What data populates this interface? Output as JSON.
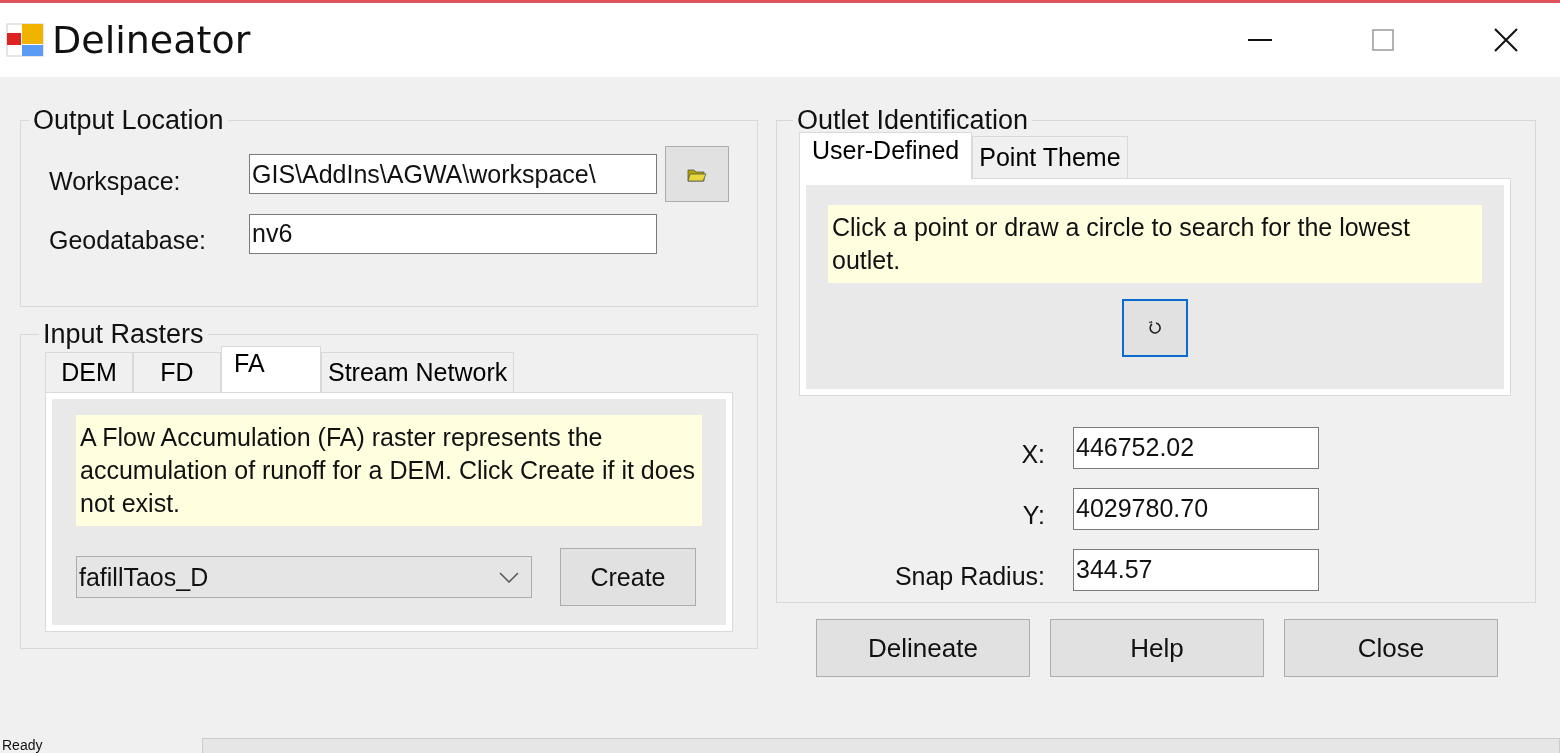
{
  "window": {
    "title": "Delineator"
  },
  "output_location": {
    "title": "Output Location",
    "workspace": {
      "label": "Workspace:",
      "value": "GIS\\AddIns\\AGWA\\workspace\\"
    },
    "geodatabase": {
      "label": "Geodatabase:",
      "value": "nv6"
    }
  },
  "input_rasters": {
    "title": "Input Rasters",
    "tabs": [
      {
        "label": "DEM",
        "selected": false
      },
      {
        "label": "FD",
        "selected": false
      },
      {
        "label": "FA",
        "selected": true
      },
      {
        "label": "Stream Network",
        "selected": false
      }
    ],
    "note": "A Flow Accumulation (FA) raster represents the accumulation of runoff for a DEM. Click Create if it does not exist.",
    "dropdown": {
      "value": "fafillTaos_D"
    },
    "create_button": "Create"
  },
  "outlet": {
    "title": "Outlet Identification",
    "tabs": [
      {
        "label": "User-Defined",
        "selected": true
      },
      {
        "label": "Point Theme",
        "selected": false
      }
    ],
    "note": "Click a point or draw a circle to search for  the lowest outlet.",
    "fields": [
      {
        "label": "X:",
        "value": "446752.02"
      },
      {
        "label": "Y:",
        "value": "4029780.70"
      },
      {
        "label": "Snap Radius:",
        "value": "344.57"
      }
    ]
  },
  "buttons": [
    "Delineate",
    "Help",
    "Close"
  ],
  "status_bar": {
    "text": "Ready"
  }
}
